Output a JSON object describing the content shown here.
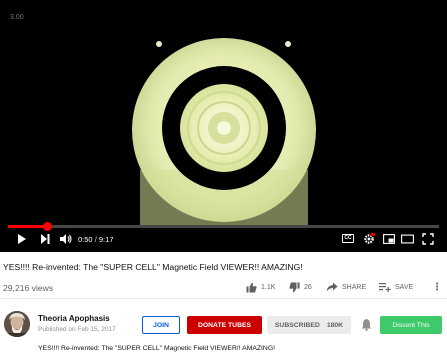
{
  "player": {
    "corner_label": "3.00",
    "progress_fraction": 0.0911,
    "current_time": "0:50",
    "separator": "/",
    "duration": "9:17",
    "captions_label": "CC"
  },
  "video": {
    "title": "YES!!!! Re-invented: The \"SUPER CELL\" Magnetic Field VIEWER!! AMAZING!",
    "views": "29,216 views"
  },
  "actions": {
    "likes": "1.1K",
    "dislikes": "26",
    "share": "SHARE",
    "save": "SAVE",
    "more": "⋮"
  },
  "channel": {
    "name": "Theoria Apophasis",
    "published": "Published on Feb 15, 2017"
  },
  "buttons": {
    "join": "JOIN",
    "donate": "DONATE TUBES",
    "subscribed": "SUBSCRIBED",
    "subscriber_count": "180K",
    "dissent": "Dissent This"
  },
  "description": {
    "text": "YES!!!! Re-invented: The \"SUPER CELL\" Magnetic Field VIEWER!! AMAZING!"
  },
  "colors": {
    "progress": "#ff0000",
    "donate": "#cc0000",
    "join": "#065fd4",
    "dissent": "#3ec96a"
  }
}
